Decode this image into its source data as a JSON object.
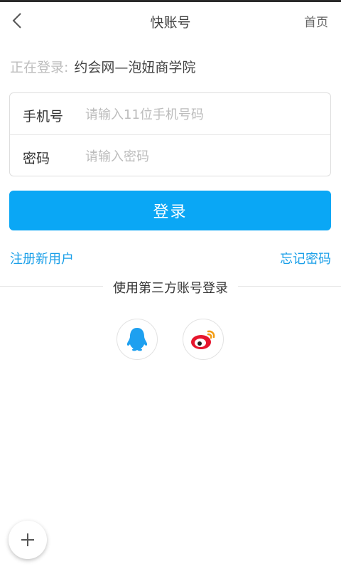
{
  "header": {
    "title": "快账号",
    "home_label": "首页",
    "back_icon": "chevron-left-icon"
  },
  "login_info": {
    "prefix": "正在登录:",
    "site": "约会网—泡妞商学院"
  },
  "form": {
    "phone_label": "手机号",
    "phone_placeholder": "请输入11位手机号码",
    "password_label": "密码",
    "password_placeholder": "请输入密码"
  },
  "login_button": "登录",
  "links": {
    "register": "注册新用户",
    "forgot": "忘记密码"
  },
  "third_party": {
    "title": "使用第三方账号登录",
    "providers": [
      {
        "icon": "qq-icon",
        "color": "#1ea0f0"
      },
      {
        "icon": "weibo-icon",
        "color": "#e6162d"
      }
    ]
  },
  "fab_icon": "plus-icon",
  "colors": {
    "accent": "#0aa7f5",
    "link": "#1a9fe8"
  }
}
